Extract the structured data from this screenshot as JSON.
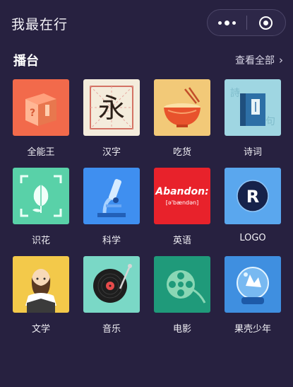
{
  "header": {
    "title": "我最在行"
  },
  "section": {
    "title": "播台",
    "view_all": "查看全部",
    "chevron": "›"
  },
  "tiles": [
    {
      "label": "全能王",
      "icon": "box-icon"
    },
    {
      "label": "汉字",
      "icon": "chinese-character-icon",
      "glyph": "永"
    },
    {
      "label": "吃货",
      "icon": "noodle-bowl-icon"
    },
    {
      "label": "诗词",
      "icon": "book-icon"
    },
    {
      "label": "识花",
      "icon": "flower-scan-icon"
    },
    {
      "label": "科学",
      "icon": "microscope-icon"
    },
    {
      "label": "英语",
      "icon": "abandon-word-icon",
      "word": "Abandon:",
      "phonetic": "[ə'bændən]"
    },
    {
      "label": "LOGO",
      "icon": "logo-r-icon",
      "badge": "R"
    },
    {
      "label": "文学",
      "icon": "shakespeare-icon"
    },
    {
      "label": "音乐",
      "icon": "record-player-icon"
    },
    {
      "label": "电影",
      "icon": "film-reel-icon"
    },
    {
      "label": "果壳少年",
      "icon": "astronaut-helmet-icon"
    }
  ]
}
